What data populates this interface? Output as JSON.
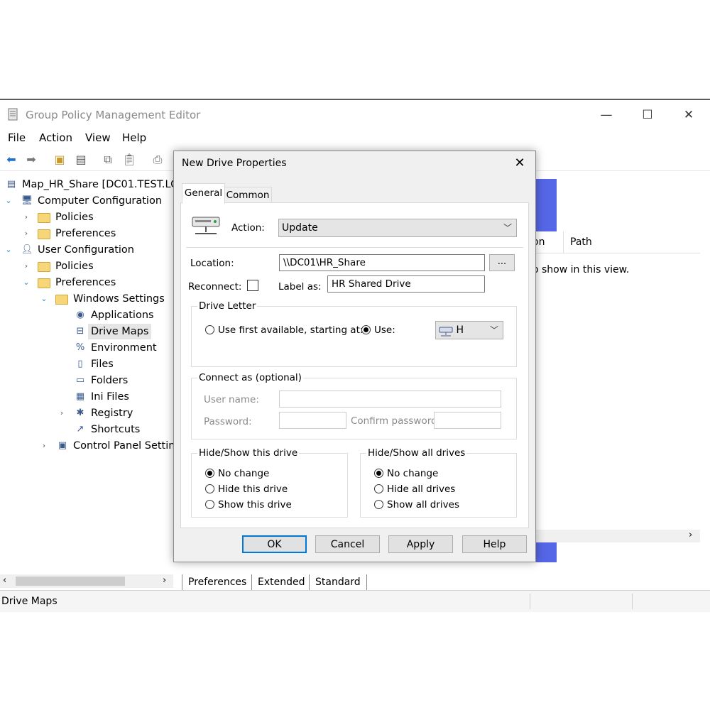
{
  "window": {
    "title": "Group Policy Management Editor",
    "menu": [
      "File",
      "Action",
      "View",
      "Help"
    ]
  },
  "tree": {
    "items": [
      {
        "label": "Map_HR_Share [DC01.TEST.LOC",
        "level": 0,
        "chevron": "",
        "icon": "gpo-icon"
      },
      {
        "label": "Computer Configuration",
        "level": 0,
        "chevron": "expanded",
        "icon": "computer-config-icon"
      },
      {
        "label": "Policies",
        "level": 1,
        "chevron": "collapsed",
        "icon": "folder-icon"
      },
      {
        "label": "Preferences",
        "level": 1,
        "chevron": "collapsed",
        "icon": "folder-icon"
      },
      {
        "label": "User Configuration",
        "level": 0,
        "chevron": "expanded",
        "icon": "user-config-icon"
      },
      {
        "label": "Policies",
        "level": 1,
        "chevron": "collapsed",
        "icon": "folder-icon"
      },
      {
        "label": "Preferences",
        "level": 1,
        "chevron": "expanded",
        "icon": "folder-icon"
      },
      {
        "label": "Windows Settings",
        "level": 2,
        "chevron": "expanded",
        "icon": "folder-icon"
      },
      {
        "label": "Applications",
        "level": 3,
        "chevron": "",
        "icon": "applications-icon"
      },
      {
        "label": "Drive Maps",
        "level": 3,
        "chevron": "",
        "icon": "drive-maps-icon",
        "selected": true
      },
      {
        "label": "Environment",
        "level": 3,
        "chevron": "",
        "icon": "environment-icon"
      },
      {
        "label": "Files",
        "level": 3,
        "chevron": "",
        "icon": "files-icon"
      },
      {
        "label": "Folders",
        "level": 3,
        "chevron": "",
        "icon": "folders-icon"
      },
      {
        "label": "Ini Files",
        "level": 3,
        "chevron": "",
        "icon": "ini-files-icon"
      },
      {
        "label": "Registry",
        "level": 3,
        "chevron": "collapsed",
        "icon": "registry-icon"
      },
      {
        "label": "Shortcuts",
        "level": 3,
        "chevron": "",
        "icon": "shortcuts-icon"
      },
      {
        "label": "Control Panel Setting",
        "level": 2,
        "chevron": "collapsed",
        "icon": "control-panel-icon"
      }
    ]
  },
  "list": {
    "col_partial": "on",
    "col_path": "Path",
    "empty_text": "o show in this view."
  },
  "bottom_tabs": [
    "Preferences",
    "Extended",
    "Standard"
  ],
  "status": "Drive Maps",
  "dialog": {
    "title": "New Drive Properties",
    "tabs": [
      "General",
      "Common"
    ],
    "action_label": "Action:",
    "action_value": "Update",
    "location_label": "Location:",
    "location_value": "\\\\DC01\\HR_Share",
    "browse_label": "...",
    "reconnect_label": "Reconnect:",
    "label_as_label": "Label as:",
    "label_as_value": "HR Shared Drive",
    "drive_letter": {
      "title": "Drive Letter",
      "first_available_label": "Use first available, starting at:",
      "use_label": "Use:",
      "mode": "use",
      "letter": "H"
    },
    "connect_as": {
      "title": "Connect as (optional)",
      "user_label": "User name:",
      "password_label": "Password:",
      "confirm_label": "Confirm password:"
    },
    "hide_show_drive": {
      "title": "Hide/Show this drive",
      "options": [
        "No change",
        "Hide this drive",
        "Show this drive"
      ],
      "selected": 0
    },
    "hide_show_all": {
      "title": "Hide/Show all drives",
      "options": [
        "No change",
        "Hide all drives",
        "Show all drives"
      ],
      "selected": 0
    },
    "buttons": {
      "ok": "OK",
      "cancel": "Cancel",
      "apply": "Apply",
      "help": "Help"
    }
  }
}
